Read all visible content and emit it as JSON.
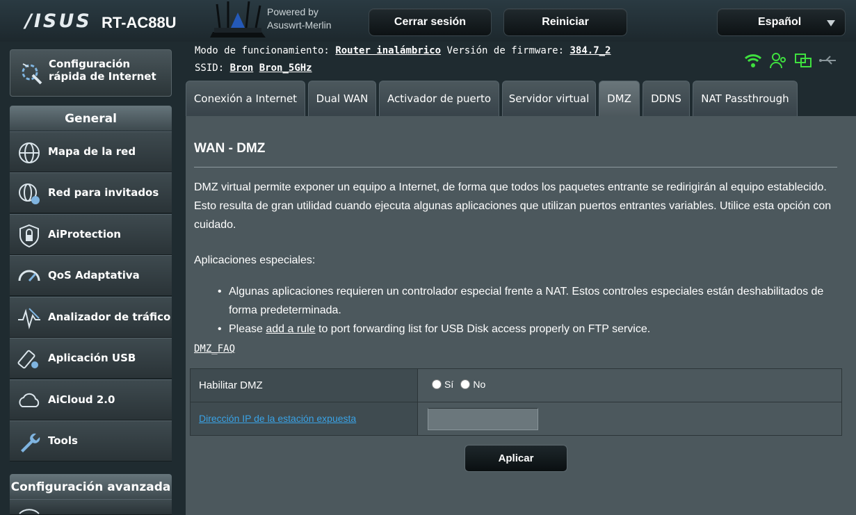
{
  "header": {
    "brand": "/ISUS",
    "model": "RT-AC88U",
    "powered_line1": "Powered by",
    "powered_line2": "Asuswrt-Merlin",
    "logout_label": "Cerrar sesión",
    "reboot_label": "Reiniciar",
    "language": "Español"
  },
  "sidebar": {
    "quick_setup": "Configuración rápida de Internet",
    "general_title": "General",
    "items": [
      {
        "label": "Mapa de la red",
        "icon": "network-map-icon"
      },
      {
        "label": "Red para invitados",
        "icon": "guest-network-icon"
      },
      {
        "label": "AiProtection",
        "icon": "shield-lock-icon"
      },
      {
        "label": "QoS Adaptativa",
        "icon": "speedometer-icon"
      },
      {
        "label": "Analizador de tráfico",
        "icon": "traffic-analyzer-icon"
      },
      {
        "label": "Aplicación USB",
        "icon": "usb-icon"
      },
      {
        "label": "AiCloud 2.0",
        "icon": "cloud-icon"
      },
      {
        "label": "Tools",
        "icon": "wrench-icon"
      }
    ],
    "advanced_title": "Configuración avanzada"
  },
  "status": {
    "mode_label": "Modo de funcionamiento:",
    "mode_value": "Router inalámbrico",
    "fw_label": "Versión de firmware:",
    "fw_value": "384.7_2",
    "ssid_label": "SSID:",
    "ssid_1": "Bron",
    "ssid_2": "Bron_5GHz"
  },
  "tabs": [
    {
      "label": "Conexión a Internet",
      "active": false
    },
    {
      "label": "Dual WAN",
      "active": false
    },
    {
      "label": "Activador de puerto",
      "active": false
    },
    {
      "label": "Servidor virtual",
      "active": false
    },
    {
      "label": "DMZ",
      "active": true
    },
    {
      "label": "DDNS",
      "active": false
    },
    {
      "label": "NAT Passthrough",
      "active": false
    }
  ],
  "content": {
    "title": "WAN - DMZ",
    "description": "DMZ virtual permite exponer un equipo a Internet, de forma que todos los paquetes entrante se redirigirán al equipo establecido. Esto resulta de gran utilidad cuando ejecuta algunas aplicaciones que utilizan puertos entrantes variables. Utilice esta opción con cuidado.",
    "special_title": "Aplicaciones especiales:",
    "bullet1": "Algunas aplicaciones requieren un controlador especial frente a NAT. Estos controles especiales están deshabilitados de forma predeterminada.",
    "bullet2_pre": "Please ",
    "bullet2_link": "add a rule",
    "bullet2_post": " to port forwarding list for USB Disk access properly on FTP service.",
    "faq": "DMZ_FAQ",
    "enable_label": "Habilitar DMZ",
    "yes_label": "Sí",
    "no_label": "No",
    "ip_label": "Dirección IP de la estación expuesta",
    "ip_value": "",
    "apply_label": "Aplicar"
  }
}
